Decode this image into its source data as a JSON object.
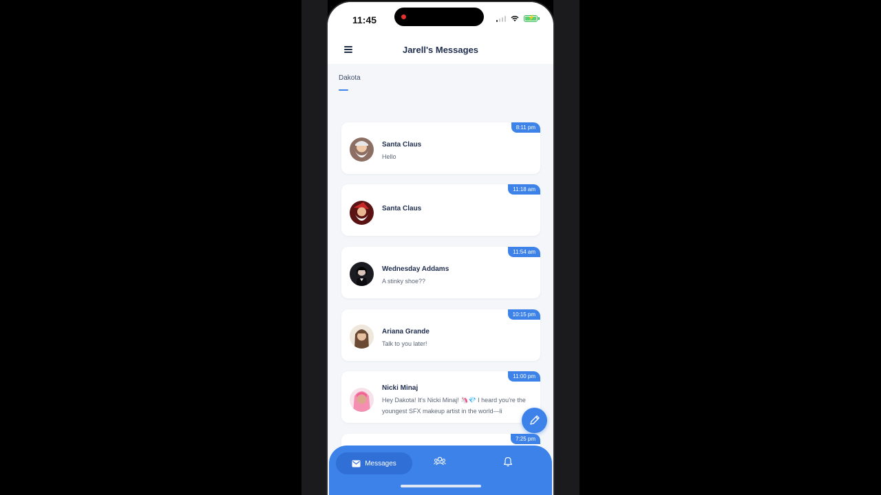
{
  "status_bar": {
    "time": "11:45"
  },
  "app_bar": {
    "title": "Jarell's Messages"
  },
  "tabs": [
    {
      "label": "Dakota",
      "selected": true
    }
  ],
  "conversations": [
    {
      "name": "Santa Claus",
      "preview": "Hello",
      "time": "8:11 pm"
    },
    {
      "name": "Santa Claus",
      "preview": "",
      "time": "11:18 am"
    },
    {
      "name": "Wednesday Addams",
      "preview": "A stinky shoe??",
      "time": "11:54 am"
    },
    {
      "name": "Ariana Grande",
      "preview": "Talk to you later!",
      "time": "10:15 pm"
    },
    {
      "name": "Nicki Minaj",
      "preview": "Hey Dakota! It's Nicki Minaj! 🦄💎 I heard you're the youngest SFX makeup artist in the world—li",
      "time": "11:00 pm"
    },
    {
      "name": "",
      "preview": "",
      "time": "7:25 pm"
    }
  ],
  "bottom_nav": {
    "messages_label": "Messages",
    "icons": [
      "mail-icon",
      "users-icon",
      "bell-icon"
    ]
  },
  "fab": {
    "icon": "pencil-icon"
  },
  "colors": {
    "accent": "#3d82e8",
    "title": "#1d2b4c",
    "background": "#f4f6f9"
  }
}
